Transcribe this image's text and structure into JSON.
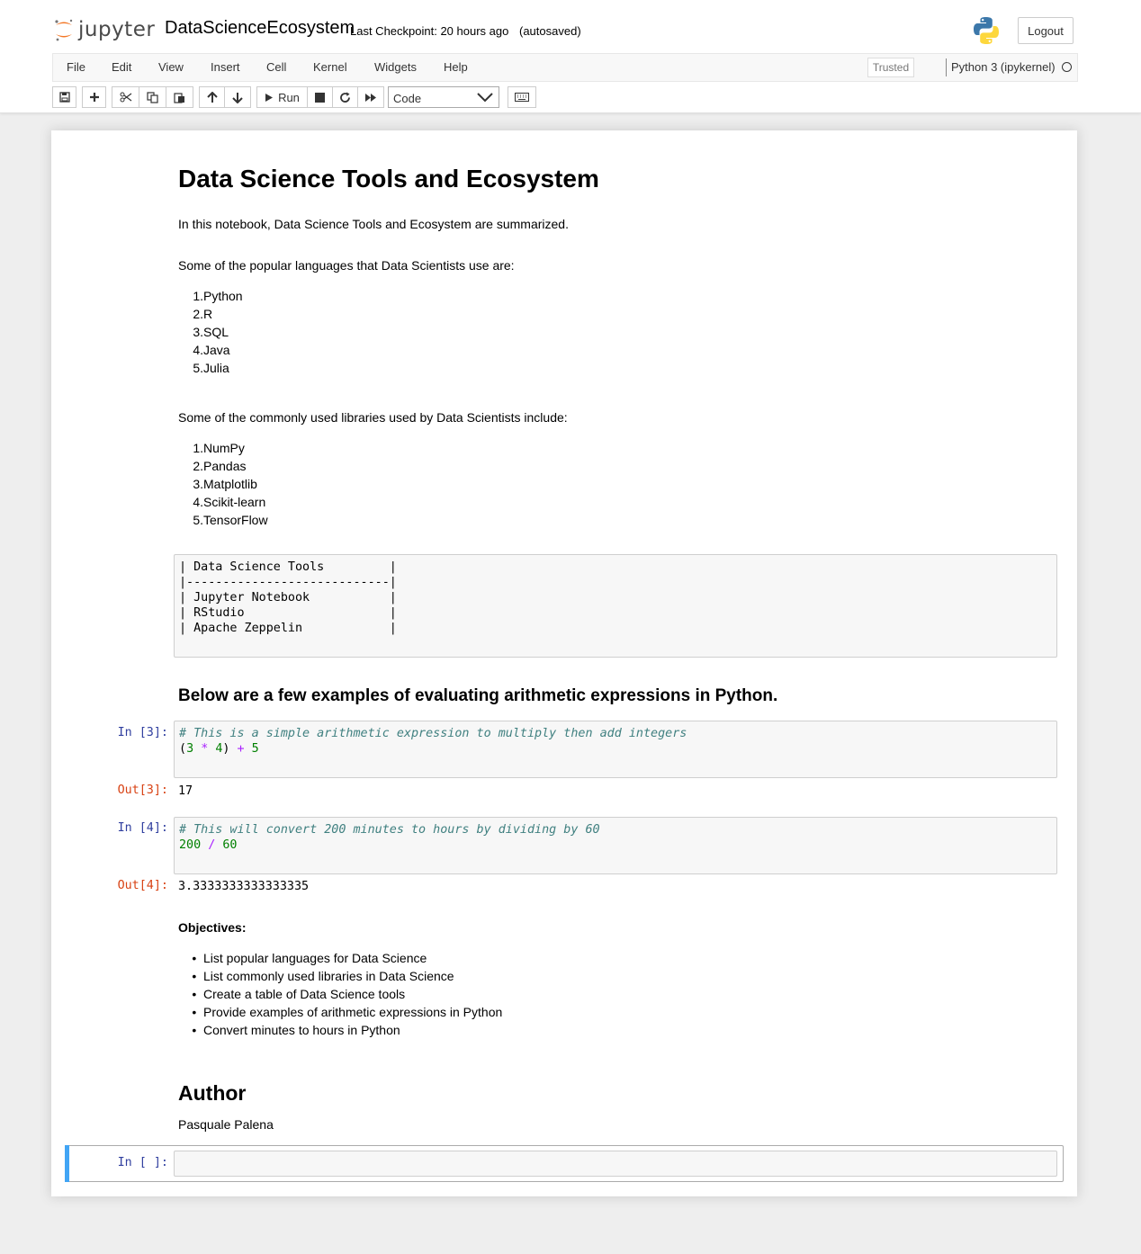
{
  "header": {
    "brand": "jupyter",
    "notebook_name": "DataScienceEcosystem",
    "checkpoint": "Last Checkpoint: 20 hours ago",
    "autosave": "(autosaved)",
    "logout_label": "Logout"
  },
  "menu": {
    "items": [
      "File",
      "Edit",
      "View",
      "Insert",
      "Cell",
      "Kernel",
      "Widgets",
      "Help"
    ],
    "trusted": "Trusted",
    "kernel": "Python 3 (ipykernel)"
  },
  "toolbar": {
    "run_label": "Run",
    "cell_type": "Code"
  },
  "cells": {
    "title": "Data Science Tools and Ecosystem",
    "intro": "In this notebook, Data Science Tools and Ecosystem are summarized.",
    "languages_intro": "Some of the popular languages that Data Scientists use are:",
    "languages": [
      "Python",
      "R",
      "SQL",
      "Java",
      "Julia"
    ],
    "libraries_intro": "Some of the commonly used libraries used by Data Scientists include:",
    "libraries": [
      "NumPy",
      "Pandas",
      "Matplotlib",
      "Scikit-learn",
      "TensorFlow"
    ],
    "table_lines": [
      "| Data Science Tools         |",
      "|----------------------------|",
      "| Jupyter Notebook           |",
      "| RStudio                    |",
      "| Apache Zeppelin            |"
    ],
    "arith_heading": "Below are a few examples of evaluating arithmetic expressions in Python.",
    "code1": {
      "prompt_in": "In [3]:",
      "comment": "# This is a simple arithmetic expression to multiply then add integers",
      "prompt_out": "Out[3]:",
      "output": "17"
    },
    "code2": {
      "prompt_in": "In [4]:",
      "comment": "# This will convert 200 minutes to hours by dividing by 60",
      "prompt_out": "Out[4]:",
      "output": "3.3333333333333335"
    },
    "objectives_heading": "Objectives:",
    "objectives": [
      "List popular languages for Data Science",
      "List commonly used libraries in Data Science",
      "Create a table of Data Science tools",
      "Provide examples of arithmetic expressions in Python",
      "Convert minutes to hours in Python"
    ],
    "author_heading": "Author",
    "author_name": "Pasquale Palena",
    "empty_prompt": "In [ ]:"
  },
  "colors": {
    "prompt_in": "#303f9f",
    "prompt_out": "#d84315",
    "selected_bar": "#42a5f5",
    "jupyter_orange": "#f37726"
  }
}
